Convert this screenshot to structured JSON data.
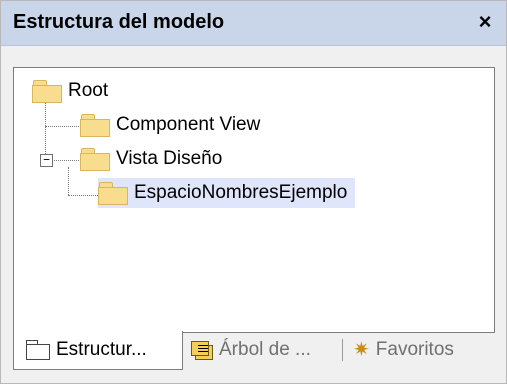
{
  "window": {
    "title": "Estructura del modelo",
    "close_glyph": "×"
  },
  "tree": {
    "nodes": [
      {
        "label": "Root",
        "icon": "folder-icon"
      },
      {
        "label": "Component View",
        "icon": "folder-icon"
      },
      {
        "label": "Vista Diseño",
        "icon": "folder-icon",
        "expander": "−"
      },
      {
        "label": "EspacioNombresEjemplo",
        "icon": "folder-icon",
        "selected": true
      }
    ]
  },
  "tabs": [
    {
      "label": "Estructur...",
      "icon": "folder-outline-icon",
      "active": true
    },
    {
      "label": "Árbol de ...",
      "icon": "list-icon",
      "active": false
    },
    {
      "label": "Favoritos",
      "icon": "star-icon",
      "active": false
    }
  ],
  "colors": {
    "titlebar": "#c9d6ea",
    "selection": "#dfe6fb",
    "folder": "#f9dd8f"
  }
}
